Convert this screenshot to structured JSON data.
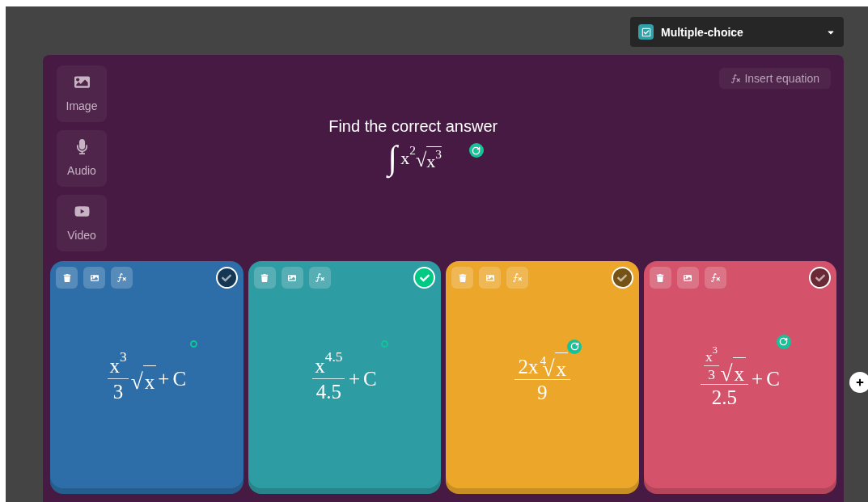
{
  "question_type": {
    "label": "Multiple-choice"
  },
  "media_buttons": [
    {
      "kind": "image",
      "label": "Image"
    },
    {
      "kind": "audio",
      "label": "Audio"
    },
    {
      "kind": "video",
      "label": "Video"
    }
  ],
  "insert_equation": {
    "label": "Insert equation"
  },
  "question": {
    "title": "Find the correct answer",
    "grammar_check": true,
    "grammar_expanded": true,
    "formula": [
      {
        "kind": "op",
        "text": "∫"
      },
      {
        "kind": "sup",
        "base": "x",
        "exp": "2"
      },
      {
        "kind": "sqrt",
        "sign": "√",
        "body": [
          {
            "kind": "sup",
            "base": "x",
            "exp": "3"
          }
        ]
      }
    ]
  },
  "answers": [
    {
      "color": "#2d6ea8",
      "correct": false,
      "grammar_check": true,
      "grammar_expanded": false,
      "formula": [
        {
          "kind": "frac",
          "num": [
            {
              "kind": "sup",
              "base": "x",
              "exp": "3"
            }
          ],
          "den": [
            {
              "kind": "text",
              "text": "3"
            }
          ]
        },
        {
          "kind": "sqrt",
          "sign": "√",
          "body": [
            {
              "kind": "text",
              "text": "x"
            }
          ]
        },
        {
          "kind": "text",
          "text": "+"
        },
        {
          "kind": "text",
          "text": "C"
        }
      ]
    },
    {
      "color": "#2d9ca3",
      "correct": true,
      "grammar_check": true,
      "grammar_expanded": false,
      "formula": [
        {
          "kind": "frac",
          "num": [
            {
              "kind": "sup",
              "base": "x",
              "exp": "4.5"
            }
          ],
          "den": [
            {
              "kind": "text",
              "text": "4.5"
            }
          ]
        },
        {
          "kind": "text",
          "text": "+"
        },
        {
          "kind": "text",
          "text": "C"
        }
      ]
    },
    {
      "color": "#eca72a",
      "correct": false,
      "grammar_check": true,
      "grammar_expanded": true,
      "formula": [
        {
          "kind": "frac",
          "num": [
            {
              "kind": "text",
              "text": "2x"
            },
            {
              "kind": "sqrt",
              "sign": "√",
              "index": "4",
              "body": [
                {
                  "kind": "text",
                  "text": "x"
                }
              ]
            }
          ],
          "den": [
            {
              "kind": "text",
              "text": "9"
            }
          ]
        }
      ]
    },
    {
      "color": "#d4526a",
      "correct": false,
      "grammar_check": true,
      "grammar_expanded": true,
      "formula": [
        {
          "kind": "frac",
          "num": [
            {
              "kind": "smallfrac",
              "num": [
                {
                  "kind": "sup",
                  "base": "x",
                  "exp": "3"
                }
              ],
              "den": [
                {
                  "kind": "text",
                  "text": "3"
                }
              ]
            },
            {
              "kind": "sqrt",
              "sign": "√",
              "body": [
                {
                  "kind": "text",
                  "text": "x"
                }
              ]
            }
          ],
          "den": [
            {
              "kind": "text",
              "text": "2.5"
            }
          ]
        },
        {
          "kind": "text",
          "text": "+"
        },
        {
          "kind": "text",
          "text": "C"
        }
      ]
    }
  ]
}
